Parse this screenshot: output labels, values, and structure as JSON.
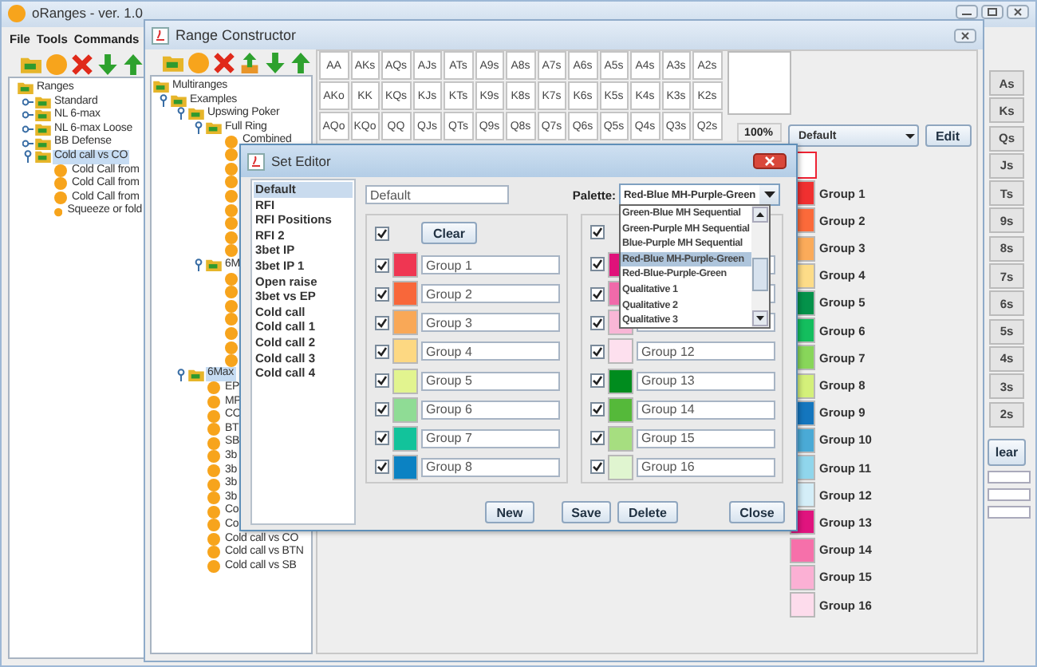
{
  "main_window": {
    "title": "oRanges - ver. 1.0",
    "menu": [
      "File",
      "Tools",
      "Commands"
    ],
    "tree": [
      {
        "label": "Ranges",
        "kind": "folder",
        "selected": false,
        "children": [
          {
            "label": "Standard",
            "kind": "folder",
            "expanded": false,
            "selected": false
          },
          {
            "label": "NL 6-max",
            "kind": "folder",
            "expanded": false,
            "selected": false
          },
          {
            "label": "NL 6-max Loose",
            "kind": "folder",
            "expanded": false,
            "selected": false
          },
          {
            "label": "BB Defense",
            "kind": "folder",
            "expanded": false,
            "selected": false
          },
          {
            "label": "Cold call vs CO",
            "kind": "folder",
            "expanded": true,
            "selected": true,
            "children": [
              {
                "label": "Cold Call from",
                "kind": "leaf",
                "selected": false
              },
              {
                "label": "Cold Call from",
                "kind": "leaf",
                "selected": false
              },
              {
                "label": "Cold Call from",
                "kind": "leaf",
                "selected": false
              },
              {
                "label": "Squeeze or fold",
                "kind": "leaf",
                "selected": false
              }
            ]
          }
        ]
      }
    ],
    "cards": [
      "As",
      "Ks",
      "Qs",
      "Js",
      "Ts",
      "9s",
      "8s",
      "7s",
      "6s",
      "5s",
      "4s",
      "3s",
      "2s"
    ],
    "clear_button": "lear"
  },
  "range_constructor": {
    "title": "Range Constructor",
    "tree": [
      {
        "label": "Multiranges",
        "kind": "folder",
        "selected": false,
        "children": [
          {
            "label": "Examples",
            "kind": "folder",
            "expanded": true,
            "selected": false,
            "children": [
              {
                "label": "Upswing Poker",
                "kind": "folder",
                "expanded": true,
                "selected": false,
                "children": [
                  {
                    "label": "Full Ring",
                    "kind": "folder",
                    "expanded": true,
                    "selected": false,
                    "children": [
                      {
                        "label": "Combined",
                        "kind": "leaf",
                        "selected": false
                      },
                      {
                        "kind": "leaf"
                      },
                      {
                        "kind": "leaf"
                      },
                      {
                        "kind": "leaf"
                      },
                      {
                        "kind": "leaf"
                      },
                      {
                        "kind": "leaf"
                      },
                      {
                        "kind": "leaf"
                      },
                      {
                        "kind": "leaf"
                      },
                      {
                        "kind": "leaf"
                      }
                    ]
                  },
                  {
                    "label": "6M",
                    "kind": "folder",
                    "expanded": true,
                    "selected": false,
                    "children": [
                      {
                        "kind": "leaf"
                      },
                      {
                        "kind": "leaf"
                      },
                      {
                        "kind": "leaf"
                      },
                      {
                        "kind": "leaf"
                      },
                      {
                        "kind": "leaf"
                      },
                      {
                        "kind": "leaf"
                      },
                      {
                        "kind": "leaf"
                      }
                    ]
                  }
                ]
              },
              {
                "label": "6Max",
                "kind": "folder",
                "expanded": true,
                "selected": true,
                "children": [
                  {
                    "label": "EP",
                    "kind": "leaf",
                    "selected": false
                  },
                  {
                    "label": "MP",
                    "kind": "leaf",
                    "selected": false
                  },
                  {
                    "label": "CO",
                    "kind": "leaf",
                    "selected": false
                  },
                  {
                    "label": "BT",
                    "kind": "leaf",
                    "selected": false
                  },
                  {
                    "label": "SB",
                    "kind": "leaf",
                    "selected": false
                  },
                  {
                    "label": "3b",
                    "kind": "leaf",
                    "selected": false
                  },
                  {
                    "label": "3b",
                    "kind": "leaf",
                    "selected": false
                  },
                  {
                    "label": "3b",
                    "kind": "leaf",
                    "selected": false
                  },
                  {
                    "label": "3b",
                    "kind": "leaf",
                    "selected": false
                  },
                  {
                    "label": "Co",
                    "kind": "leaf",
                    "selected": false
                  },
                  {
                    "label": "Co",
                    "kind": "leaf",
                    "selected": false
                  },
                  {
                    "label": "Cold call vs CO",
                    "kind": "leaf",
                    "selected": false
                  },
                  {
                    "label": "Cold call vs BTN",
                    "kind": "leaf",
                    "selected": false
                  },
                  {
                    "label": "Cold call vs SB",
                    "kind": "leaf",
                    "selected": false
                  }
                ]
              }
            ]
          }
        ]
      }
    ],
    "hands": [
      [
        "AA",
        "AKs",
        "AQs",
        "AJs",
        "ATs",
        "A9s",
        "A8s",
        "A7s",
        "A6s",
        "A5s",
        "A4s",
        "A3s",
        "A2s"
      ],
      [
        "AKo",
        "KK",
        "KQs",
        "KJs",
        "KTs",
        "K9s",
        "K8s",
        "K7s",
        "K6s",
        "K5s",
        "K4s",
        "K3s",
        "K2s"
      ],
      [
        "AQo",
        "KQo",
        "QQ",
        "QJs",
        "QTs",
        "Q9s",
        "Q8s",
        "Q7s",
        "Q6s",
        "Q5s",
        "Q4s",
        "Q3s",
        "Q2s"
      ]
    ],
    "weight": "100%",
    "set_select": "Default",
    "edit_button": "Edit",
    "legend": [
      {
        "label": "Group 1",
        "color": "#f03030"
      },
      {
        "label": "Group 2",
        "color": "#fb6a3a"
      },
      {
        "label": "Group 3",
        "color": "#fbab5a"
      },
      {
        "label": "Group 4",
        "color": "#fddc88"
      },
      {
        "label": "Group 5",
        "color": "#04924a"
      },
      {
        "label": "Group 6",
        "color": "#14be5e"
      },
      {
        "label": "Group 7",
        "color": "#88d65a"
      },
      {
        "label": "Group 8",
        "color": "#d4f07a"
      },
      {
        "label": "Group 9",
        "color": "#1476be"
      },
      {
        "label": "Group 10",
        "color": "#4aaad6"
      },
      {
        "label": "Group 11",
        "color": "#90d6ec"
      },
      {
        "label": "Group 12",
        "color": "#d4eef8"
      },
      {
        "label": "Group 13",
        "color": "#e0147e"
      },
      {
        "label": "Group 14",
        "color": "#f670aa"
      },
      {
        "label": "Group 15",
        "color": "#fbb0d4"
      },
      {
        "label": "Group 16",
        "color": "#fddcec"
      }
    ]
  },
  "set_editor": {
    "title": "Set Editor",
    "sets": [
      {
        "label": "Default",
        "selected": true
      },
      {
        "label": "RFI",
        "selected": false
      },
      {
        "label": "RFI Positions",
        "selected": false
      },
      {
        "label": "RFI 2",
        "selected": false
      },
      {
        "label": "3bet IP",
        "selected": false
      },
      {
        "label": "3bet IP 1",
        "selected": false
      },
      {
        "label": "Open raise",
        "selected": false
      },
      {
        "label": "3bet vs EP",
        "selected": false
      },
      {
        "label": "Cold call",
        "selected": false
      },
      {
        "label": "Cold call 1",
        "selected": false
      },
      {
        "label": "Cold call 2",
        "selected": false
      },
      {
        "label": "Cold call 3",
        "selected": false
      },
      {
        "label": "Cold call 4",
        "selected": false
      }
    ],
    "name_value": "Default",
    "palette_label": "Palette:",
    "palette_value": "Red-Blue MH-Purple-Green",
    "palette_options": [
      {
        "label": "Green-Blue MH Sequential",
        "selected": false
      },
      {
        "label": "Green-Purple MH Sequential",
        "selected": false
      },
      {
        "label": "Blue-Purple MH Sequential",
        "selected": false
      },
      {
        "label": "Red-Blue MH-Purple-Green",
        "selected": true
      },
      {
        "label": "Red-Blue-Purple-Green",
        "selected": false
      },
      {
        "label": "Qualitative 1",
        "selected": false
      },
      {
        "label": "Qualitative 2",
        "selected": false
      },
      {
        "label": "Qualitative 3",
        "selected": false
      }
    ],
    "clear_button": "Clear",
    "select_all_left": true,
    "select_all_right": true,
    "groups": [
      {
        "label": "Group 1",
        "color": "#ef3652",
        "checked": true
      },
      {
        "label": "Group 2",
        "color": "#f8673a",
        "checked": true
      },
      {
        "label": "Group 3",
        "color": "#f9a857",
        "checked": true
      },
      {
        "label": "Group 4",
        "color": "#fdd882",
        "checked": true
      },
      {
        "label": "Group 5",
        "color": "#e2f48f",
        "checked": true
      },
      {
        "label": "Group 6",
        "color": "#8fdc95",
        "checked": true
      },
      {
        "label": "Group 7",
        "color": "#12c39b",
        "checked": true
      },
      {
        "label": "Group 8",
        "color": "#0b82c3",
        "checked": true
      },
      {
        "color": "#e0127a",
        "checked": true
      },
      {
        "color": "#f06aaa",
        "checked": true
      },
      {
        "color": "#f9b6d6",
        "checked": true
      },
      {
        "label": "Group 12",
        "color": "#fde0ee",
        "checked": true
      },
      {
        "label": "Group 13",
        "color": "#008c1e",
        "checked": true
      },
      {
        "label": "Group 14",
        "color": "#55b93a",
        "checked": true
      },
      {
        "label": "Group 15",
        "color": "#a6de80",
        "checked": true
      },
      {
        "label": "Group 16",
        "color": "#e0f5d0",
        "checked": true
      }
    ],
    "buttons": [
      "New",
      "Save",
      "Delete",
      "Close"
    ]
  }
}
